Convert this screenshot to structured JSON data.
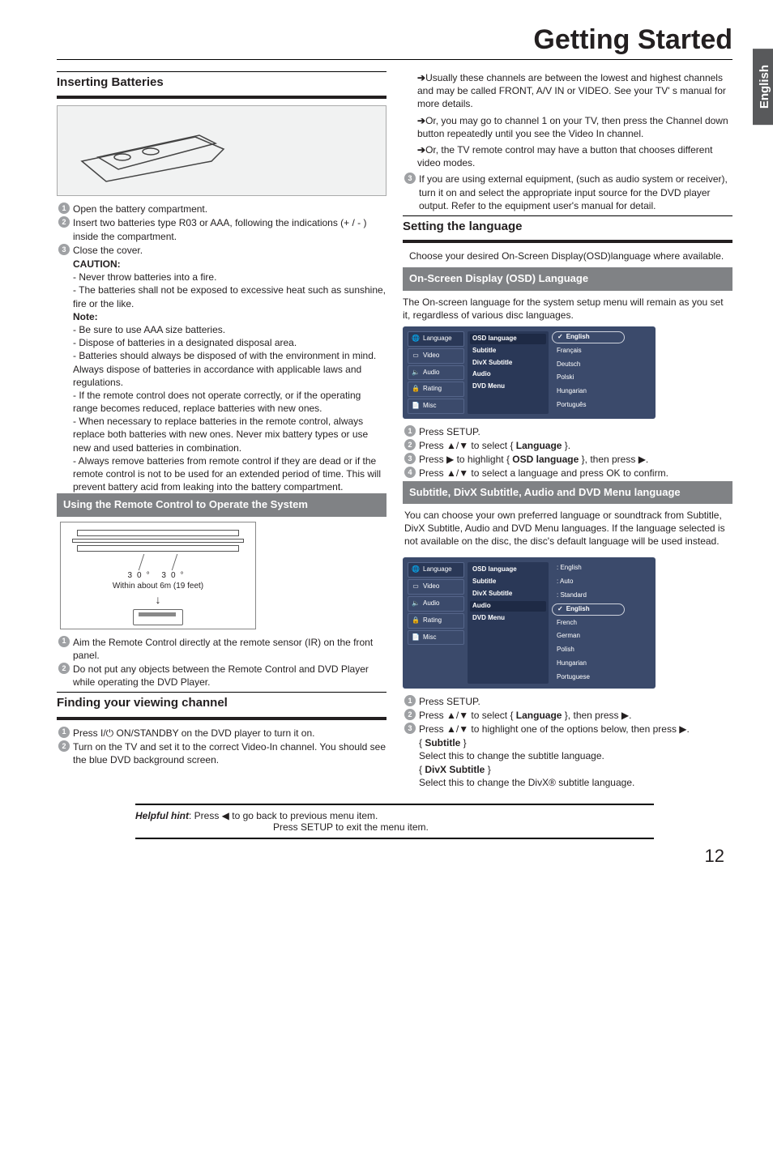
{
  "doc": {
    "title": "Getting Started",
    "side_tab": "English",
    "page_number": "12",
    "hint_lead": "Helpful hint",
    "hint_line1": ":  Press ◀ to go back to previous menu item.",
    "hint_line2": "Press SETUP to exit the menu item."
  },
  "left": {
    "sect1": "Inserting Batteries",
    "steps1": [
      "Open the battery compartment.",
      "Insert two batteries type R03 or AAA, following the indications (+ / - ) inside the compartment.",
      "Close the cover."
    ],
    "caution_head": "CAUTION:",
    "caution_lines": [
      "- Never throw batteries into a fire.",
      "- The batteries shall not be exposed to excessive heat such as sunshine, fire or the like."
    ],
    "note_head": "Note:",
    "note_lines": [
      "- Be sure to use AAA size batteries.",
      "- Dispose of batteries in a designated disposal area.",
      "- Batteries should always be disposed of with the environment in mind. Always dispose of batteries in accordance with applicable laws and regulations.",
      "- If the remote control does not operate correctly, or if the operating range becomes reduced, replace batteries with new ones.",
      "- When necessary to replace batteries in the remote control, always replace both batteries with new ones. Never mix battery types or use new and used batteries in combination.",
      "- Always remove batteries from remote control if they are dead or if the remote control is not to be used for an extended period of time. This will prevent battery acid from leaking into the battery compartment."
    ],
    "band_remote": "Using the Remote Control to Operate the System",
    "remote_angle": "30°    30°",
    "remote_range": "Within about 6m (19 feet)",
    "steps2": [
      "Aim the Remote Control directly at the remote sensor (IR) on the front panel.",
      "Do not put any objects between the Remote Control and DVD Player while operating the DVD Player."
    ],
    "sect3": "Finding your viewing channel",
    "steps3": [
      "Press I/⏻ ON/STANDBY on the DVD player to turn it on.",
      "Turn on the TV and set it to the correct Video-In channel. You should see the blue DVD background screen."
    ]
  },
  "right": {
    "para1a": "Usually these channels are between the lowest and highest channels and may be called FRONT, A/V IN or VIDEO. See your TV' s manual for more details.",
    "para1b": "Or, you may go to channel 1 on your TV, then press the Channel down button repeatedly until you see the Video In channel.",
    "para1c": "Or, the TV remote control may have a button that chooses different video modes.",
    "step3": "If you are using external equipment, (such as audio  system or receiver), turn it on and select the appropriate input source for the DVD player output. Refer to the equipment user's manual for detail.",
    "sect_lang": "Setting the language",
    "lang_intro": "Choose your desired On-Screen Display(OSD)language where available.",
    "band_osd": "On-Screen Display (OSD) Language",
    "osd_intro": "The On-screen language for the system setup menu will remain as you set it, regardless of various disc languages.",
    "osd_side": [
      "Language",
      "Video",
      "Audio",
      "Rating",
      "Misc"
    ],
    "osd_mid": [
      "OSD language",
      "Subtitle",
      "DivX Subtitle",
      "Audio",
      "DVD Menu"
    ],
    "osd_opts": [
      "English",
      "Français",
      "Deutsch",
      "Polski",
      "Hungarian",
      "Português"
    ],
    "osd_steps": [
      "Press SETUP.",
      "Press ▲/▼ to select { Language }.",
      "Press ▶ to highlight { OSD language }, then press ▶.",
      "Press ▲/▼ to select a language and press OK to confirm."
    ],
    "osd_step2_bold": "Language",
    "osd_step3_bold": "OSD language",
    "band_sub": "Subtitle, DivX Subtitle, Audio and DVD Menu language",
    "sub_intro": "You can choose your own preferred language or soundtrack from Subtitle, DivX Subtitle, Audio and DVD Menu languages. If the language selected is not available on the disc, the disc's default language will be used instead.",
    "sub_right_vals": [
      ": English",
      ": Auto",
      ": Standard"
    ],
    "sub_opts": [
      "English",
      "French",
      "German",
      "Polish",
      "Hungarian",
      "Portuguese"
    ],
    "sub_steps": [
      "Press SETUP.",
      "Press ▲/▼ to select { Language }, then press ▶.",
      "Press ▲/▼ to highlight one of the options below, then press ▶."
    ],
    "sub_step2_bold": "Language",
    "opt1_head": "Subtitle",
    "opt1_body": "Select this to change the subtitle language.",
    "opt2_head": "DivX Subtitle",
    "opt2_body": "Select this to change the DivX® subtitle language."
  }
}
